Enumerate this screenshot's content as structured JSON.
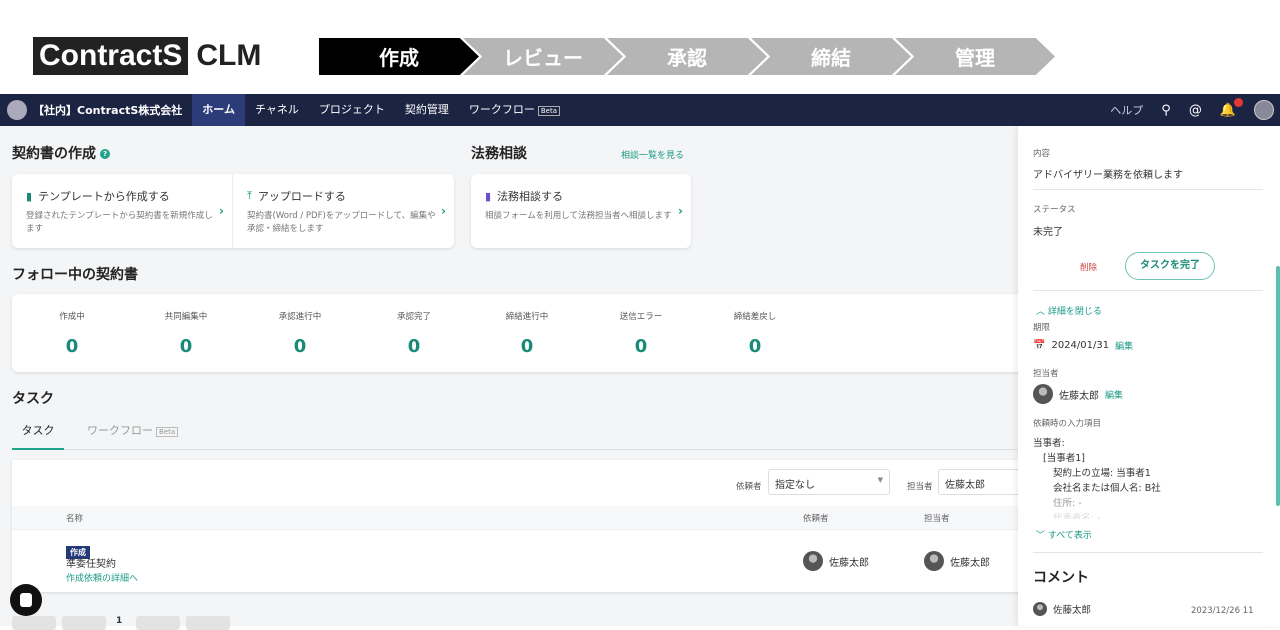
{
  "banner": {
    "logo_main": "ContractS",
    "logo_sub": "CLM",
    "steps": [
      "作成",
      "レビュー",
      "承認",
      "締結",
      "管理"
    ]
  },
  "nav": {
    "org": "【社内】ContractS株式会社",
    "items": [
      "ホーム",
      "チャネル",
      "プロジェクト",
      "契約管理",
      "ワークフロー"
    ],
    "beta": "Beta",
    "help": "ヘルプ"
  },
  "create": {
    "title": "契約書の作成",
    "help": "?",
    "actions": [
      {
        "title": "テンプレートから作成する",
        "desc": "登録されたテンプレートから契約書を新規作成します"
      },
      {
        "title": "アップロードする",
        "desc": "契約書(Word / PDF)をアップロードして、編集や承認・締結をします"
      }
    ]
  },
  "legal": {
    "title": "法務相談",
    "link": "相談一覧を見る",
    "action": {
      "title": "法務相談する",
      "desc": "相談フォームを利用して法務担当者へ相談します"
    }
  },
  "follow": {
    "title": "フォロー中の契約書",
    "stats": [
      {
        "label": "作成中",
        "value": 0
      },
      {
        "label": "共同編集中",
        "value": 0
      },
      {
        "label": "承認進行中",
        "value": 0
      },
      {
        "label": "承認完了",
        "value": 0
      },
      {
        "label": "締結進行中",
        "value": 0
      },
      {
        "label": "送信エラー",
        "value": 0
      },
      {
        "label": "締結差戻し",
        "value": 0
      }
    ]
  },
  "tasks": {
    "title": "タスク",
    "tabs": [
      "タスク",
      "ワークフロー"
    ],
    "beta": "Beta",
    "filter_requester_label": "依頼者",
    "filter_requester_value": "指定なし",
    "filter_assignee_label": "担当者",
    "filter_assignee_value": "佐藤太郎",
    "columns": [
      "名称",
      "依頼者",
      "担当者"
    ],
    "rows": [
      {
        "tag": "作成",
        "name": "準委任契約",
        "link": "作成依頼の詳細へ",
        "requester": "佐藤太郎",
        "assignee": "佐藤太郎"
      }
    ],
    "page": "1"
  },
  "panel": {
    "content_label": "内容",
    "content_value": "アドバイザリー業務を依頼します",
    "status_label": "ステータス",
    "status_value": "未完了",
    "delete": "削除",
    "complete": "タスクを完了",
    "collapse": "詳細を閉じる",
    "due_label": "期限",
    "due_value": "2024/01/31",
    "edit": "編集",
    "assignee_label": "担当者",
    "assignee_value": "佐藤太郎",
    "inputs_label": "依頼時の入力項目",
    "inputs": [
      "当事者:",
      "[当事者1]",
      "契約上の立場: 当事者1",
      "会社名または個人名: B社",
      "住所: -",
      "代表者名: -"
    ],
    "show_all": "すべて表示",
    "comment_title": "コメント",
    "comment_author": "佐藤太郎",
    "comment_time": "2023/12/26 11"
  },
  "colors": {
    "accent": "#1fa38a",
    "nav": "#1b2442"
  }
}
